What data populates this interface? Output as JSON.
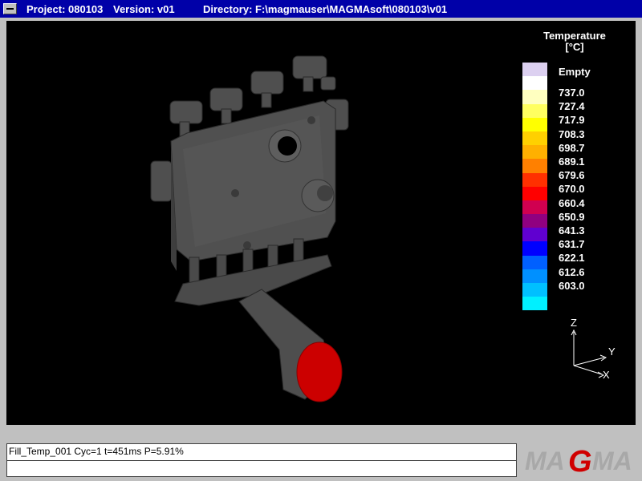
{
  "window": {
    "project": "Project: 080103",
    "version": "Version: v01",
    "directory": "Directory: F:\\magmauser\\MAGMAsoft\\080103\\v01"
  },
  "legend": {
    "title_line1": "Temperature",
    "title_line2": "[°C]",
    "empty_label": "Empty",
    "colors": {
      "empty": "#dcd0f0",
      "scale": [
        "#ffffff",
        "#ffffc0",
        "#ffff60",
        "#ffff00",
        "#ffd000",
        "#ffb000",
        "#ff8000",
        "#ff3000",
        "#ff0000",
        "#d00050",
        "#900080",
        "#6000d0",
        "#0000ff",
        "#0060ff",
        "#0090ff",
        "#00c0ff",
        "#00f0ff"
      ]
    },
    "values": [
      "737.0",
      "727.4",
      "717.9",
      "708.3",
      "698.7",
      "689.1",
      "679.6",
      "670.0",
      "660.4",
      "650.9",
      "641.3",
      "631.7",
      "622.1",
      "612.6",
      "603.0"
    ]
  },
  "axes": {
    "z": "Z",
    "y": "Y",
    "x": "X"
  },
  "status": {
    "line1": "Fill_Temp_001 Cyc=1 t=451ms P=5.91%",
    "line2": ""
  },
  "logo": {
    "text_left": "MA",
    "text_g": "G",
    "text_right": "MA",
    "color_gray": "#a8a8a8",
    "color_red": "#d00000"
  },
  "casting": {
    "body_color": "#505050",
    "inlet_color": "#cc0000"
  }
}
